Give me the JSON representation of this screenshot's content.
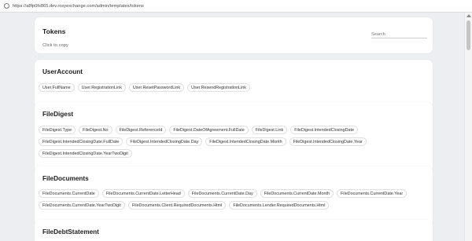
{
  "browser": {
    "url": "https://a8fp0fs865.dev.rosyexchange.com/admin/templates/tokens"
  },
  "header": {
    "title": "Tokens",
    "hint": "Click to copy",
    "search_placeholder": "Search"
  },
  "sections": [
    {
      "title": "UserAccount",
      "tokens": [
        "User.FullName",
        "User.RegistrationLink",
        "User.ResetPasswordLink",
        "User.ResendRegistrationLink"
      ]
    },
    {
      "title": "FileDigest",
      "tokens": [
        "FileDigest.Type",
        "FileDigest.No",
        "FileDigest.ReferenceId",
        "FileDigest.DateOfAgreement.FullDate",
        "FileDigest.Link",
        "FileDigest.IntendedClosingDate",
        "FileDigest.IntendedClosingDate.FullDate",
        "FileDigest.IntendedClosingDate.Day",
        "FileDigest.IntendedClosingDate.Month",
        "FileDigest.IntendedClosingDate.Year",
        "FileDigest.IntendedClosingDate.YearTwoDigit"
      ]
    },
    {
      "title": "FileDocuments",
      "tokens": [
        "FileDocuments.CurrentDate",
        "FileDocuments.CurrentDate.LetterHead",
        "FileDocuments.CurrentDate.Day",
        "FileDocuments.CurrentDate.Month",
        "FileDocuments.CurrentDate.Year",
        "FileDocuments.CurrentDate.YearTwoDigit",
        "FileDocuments.Client.RequiredDocuments.Html",
        "FileDocuments.Lender.RequiredDocuments.Html"
      ]
    },
    {
      "title": "FileDebtStatement",
      "tokens": []
    }
  ]
}
